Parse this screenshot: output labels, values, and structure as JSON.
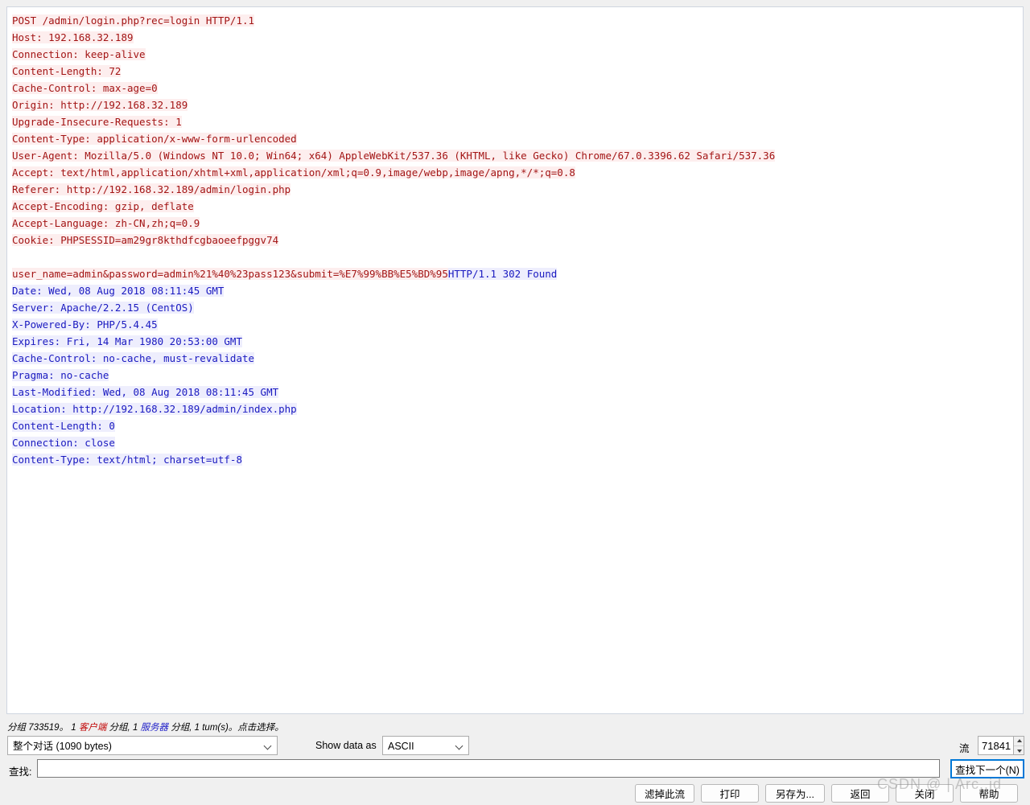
{
  "stream": {
    "request_lines": [
      "POST /admin/login.php?rec=login HTTP/1.1",
      "Host: 192.168.32.189",
      "Connection: keep-alive",
      "Content-Length: 72",
      "Cache-Control: max-age=0",
      "Origin: http://192.168.32.189",
      "Upgrade-Insecure-Requests: 1",
      "Content-Type: application/x-www-form-urlencoded",
      "User-Agent: Mozilla/5.0 (Windows NT 10.0; Win64; x64) AppleWebKit/537.36 (KHTML, like Gecko) Chrome/67.0.3396.62 Safari/537.36",
      "Accept: text/html,application/xhtml+xml,application/xml;q=0.9,image/webp,image/apng,*/*;q=0.8",
      "Referer: http://192.168.32.189/admin/login.php",
      "Accept-Encoding: gzip, deflate",
      "Accept-Language: zh-CN,zh;q=0.9",
      "Cookie: PHPSESSID=am29gr8kthdfcgbaoeefpggv74"
    ],
    "post_body": "user_name=admin&password=admin%21%40%23pass123&submit=%E7%99%BB%E5%BD%95",
    "response_status": "HTTP/1.1 302 Found",
    "response_lines": [
      "Date: Wed, 08 Aug 2018 08:11:45 GMT",
      "Server: Apache/2.2.15 (CentOS)",
      "X-Powered-By: PHP/5.4.45",
      "Expires: Fri, 14 Mar 1980 20:53:00 GMT",
      "Cache-Control: no-cache, must-revalidate",
      "Pragma: no-cache",
      "Last-Modified: Wed, 08 Aug 2018 08:11:45 GMT",
      "Location: http://192.168.32.189/admin/index.php",
      "Content-Length: 0",
      "Connection: close",
      "Content-Type: text/html; charset=utf-8"
    ],
    "colors": {
      "request_text": "#a31515",
      "request_bg": "#fdeeee",
      "response_text": "#1a1ac0",
      "response_bg": "#eeeefd"
    }
  },
  "status": {
    "prefix": "分组 733519。 1 ",
    "client_word": "客户端",
    "middle": " 分组, 1 ",
    "server_word": "服务器",
    "suffix": " 分组, 1 tum(s)。点击选择。"
  },
  "controls": {
    "conversation_select": "整个对话 (1090 bytes)",
    "show_data_as_label": "Show data as",
    "data_format_select": "ASCII",
    "stream_label": "流",
    "stream_number": "71841",
    "find_label": "查找:",
    "find_value": "",
    "find_placeholder": "",
    "find_next_label": "查找下一个(N)"
  },
  "buttons": {
    "filter_out_stream": "滤掉此流",
    "print": "打印",
    "save_as": "另存为...",
    "back": "返回",
    "close": "关闭",
    "help": "帮助"
  },
  "watermark": {
    "text": "CSDN @ | Arc..jd"
  }
}
